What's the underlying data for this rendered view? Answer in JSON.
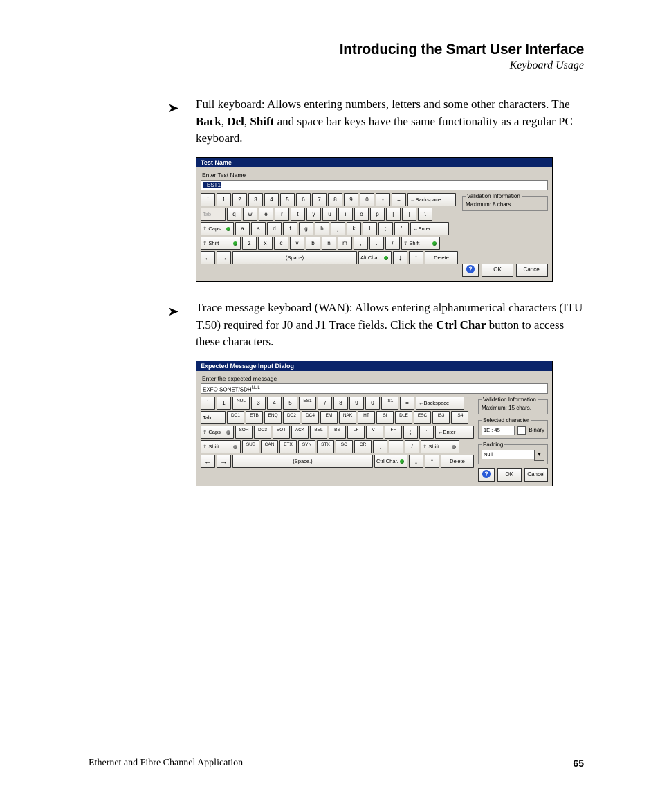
{
  "header": {
    "title": "Introducing the Smart User Interface",
    "subtitle": "Keyboard Usage"
  },
  "para1": {
    "pre": "Full keyboard: Allows entering numbers, letters and some other characters. The ",
    "b1": "Back",
    "mid1": ", ",
    "b2": "Del",
    "mid2": ", ",
    "b3": "Shift",
    "post": " and space bar keys have the same functionality as a regular PC keyboard."
  },
  "para2": {
    "pre": "Trace message keyboard (WAN): Allows entering alphanumerical characters (ITU T.50) required for J0 and J1 Trace fields. Click the ",
    "b1": "Ctrl Char",
    "post": " button to access these characters."
  },
  "shot1": {
    "title": "Test Name",
    "prompt": "Enter Test Name",
    "value": "TEST1",
    "row1": [
      "`",
      "1",
      "2",
      "3",
      "4",
      "5",
      "6",
      "7",
      "8",
      "9",
      "0",
      "-",
      "="
    ],
    "row2": [
      "q",
      "w",
      "e",
      "r",
      "t",
      "y",
      "u",
      "i",
      "o",
      "p",
      "[",
      "]",
      "\\"
    ],
    "row3": [
      "a",
      "s",
      "d",
      "f",
      "g",
      "h",
      "j",
      "k",
      "l",
      ";",
      "'"
    ],
    "row4": [
      "z",
      "x",
      "c",
      "v",
      "b",
      "n",
      "m",
      ",",
      ".",
      "/"
    ],
    "backspace": "←Backspace",
    "tab": "Tab",
    "caps": "⇧ Caps",
    "enter": "←Enter",
    "shift": "⇧ Shift",
    "rshift": "⇧ Shift",
    "space": "(Space)",
    "alt": "Alt Char.",
    "delete": "Delete",
    "down": "↓",
    "up": "↑",
    "left": "←",
    "right": "→",
    "validation_legend": "Validation Information",
    "validation": "Maximum:   8 chars.",
    "help": "?",
    "ok": "OK",
    "cancel": "Cancel"
  },
  "shot2": {
    "title": "Expected Message Input Dialog",
    "prompt": "Enter the expected message",
    "value": "EXFO SONET/SDH",
    "value_suffix": "NUL",
    "row1": [
      "`",
      "1",
      "NUL",
      "3",
      "4",
      "5",
      "ES1",
      "7",
      "8",
      "9",
      "0",
      "IS1",
      "="
    ],
    "row2": [
      "DC1",
      "ETB",
      "ENQ",
      "DC2",
      "DC4",
      "EM",
      "NAK",
      "HT",
      "SI",
      "DLE",
      "ESC",
      "IS3",
      "IS4"
    ],
    "row3": [
      "SOH",
      "DC3",
      "EOT",
      "ACK",
      "BEL",
      "BS",
      "LF",
      "VT",
      "FF",
      ";",
      "'"
    ],
    "row4": [
      "SUB",
      "CAN",
      "ETX",
      "SYN",
      "STX",
      "SO",
      "CR",
      ",",
      ".",
      "/"
    ],
    "backspace": "←Backspace",
    "tab": "Tab",
    "caps": "⇧ Caps",
    "enter": "←Enter",
    "shift": "⇧ Shift",
    "rshift": "⇧ Shift",
    "space": "(Space.)",
    "ctrl": "Ctrl Char.",
    "delete": "Delete",
    "down": "↓",
    "up": "↑",
    "left": "←",
    "right": "→",
    "validation_legend": "Validation Information",
    "validation": "Maximum:   15 chars.",
    "selchar_legend": "Selected character",
    "selchar_value": "1E : 45",
    "binary": "Binary",
    "padding_legend": "Padding",
    "padding_value": "Null",
    "help": "?",
    "ok": "OK",
    "cancel": "Cancel"
  },
  "footer": {
    "left": "Ethernet and Fibre Channel Application",
    "page": "65"
  }
}
